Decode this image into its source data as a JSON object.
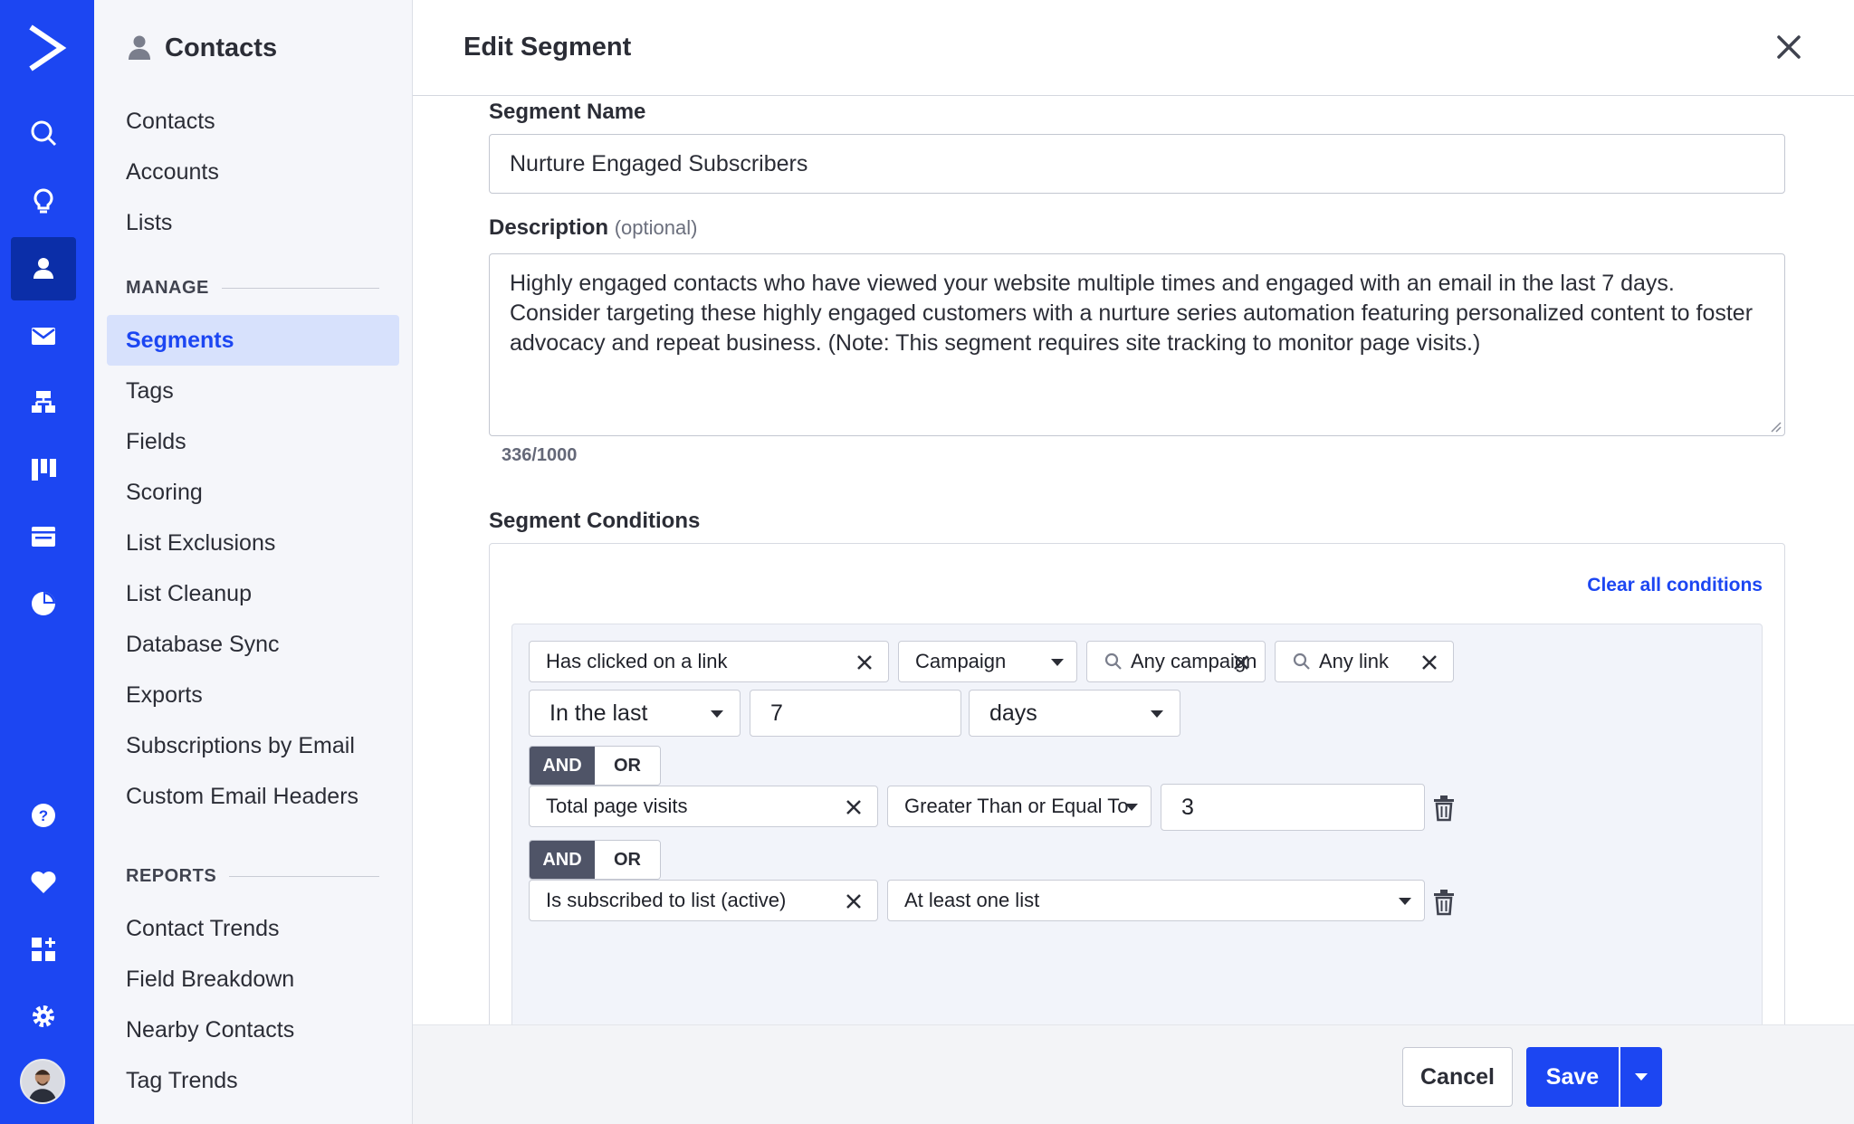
{
  "rail": {
    "items": [
      {
        "icon": "search-icon"
      },
      {
        "icon": "lightbulb-icon"
      },
      {
        "icon": "contacts-icon",
        "active": true
      },
      {
        "icon": "mail-icon"
      },
      {
        "icon": "automation-icon"
      },
      {
        "icon": "deals-icon"
      },
      {
        "icon": "website-icon"
      },
      {
        "icon": "reports-icon"
      }
    ],
    "bottom": [
      {
        "icon": "help-icon"
      },
      {
        "icon": "heart-icon"
      },
      {
        "icon": "apps-icon"
      },
      {
        "icon": "settings-icon"
      }
    ],
    "accent": "#1c46f2"
  },
  "sidebar": {
    "title": "Contacts",
    "items": [
      "Contacts",
      "Accounts",
      "Lists"
    ],
    "manage_label": "MANAGE",
    "manage_items": [
      "Segments",
      "Tags",
      "Fields",
      "Scoring",
      "List Exclusions",
      "List Cleanup",
      "Database Sync",
      "Exports",
      "Subscriptions by Email",
      "Custom Email Headers"
    ],
    "active_item": "Segments",
    "reports_label": "REPORTS",
    "reports_items": [
      "Contact Trends",
      "Field Breakdown",
      "Nearby Contacts",
      "Tag Trends"
    ]
  },
  "panel": {
    "title": "Edit Segment",
    "name_label": "Segment Name",
    "name_value": "Nurture Engaged Subscribers",
    "desc_label": "Description",
    "desc_optional": "(optional)",
    "desc_value": "Highly engaged contacts who have viewed your website multiple times and engaged with an email in the last 7 days. Consider targeting these highly engaged customers with a nurture series automation featuring  personalized content to foster advocacy and repeat business. (Note: This segment requires site tracking to monitor page visits.)",
    "desc_counter": "336/1000",
    "conditions_label": "Segment Conditions",
    "clear_all": "Clear all conditions"
  },
  "conditions": {
    "row1": {
      "field": "Has clicked on a link",
      "type": "Campaign",
      "campaign": "Any campaign",
      "link": "Any link"
    },
    "row2": {
      "range": "In the last",
      "amount": "7",
      "unit": "days"
    },
    "toggle1": {
      "and": "AND",
      "or": "OR",
      "selected": "AND"
    },
    "row3": {
      "field": "Total page visits",
      "operator": "Greater Than or Equal To",
      "value": "3"
    },
    "toggle2": {
      "and": "AND",
      "or": "OR",
      "selected": "AND"
    },
    "row4": {
      "field": "Is subscribed to list (active)",
      "operator": "At least one list"
    }
  },
  "footer": {
    "cancel": "Cancel",
    "save": "Save"
  }
}
